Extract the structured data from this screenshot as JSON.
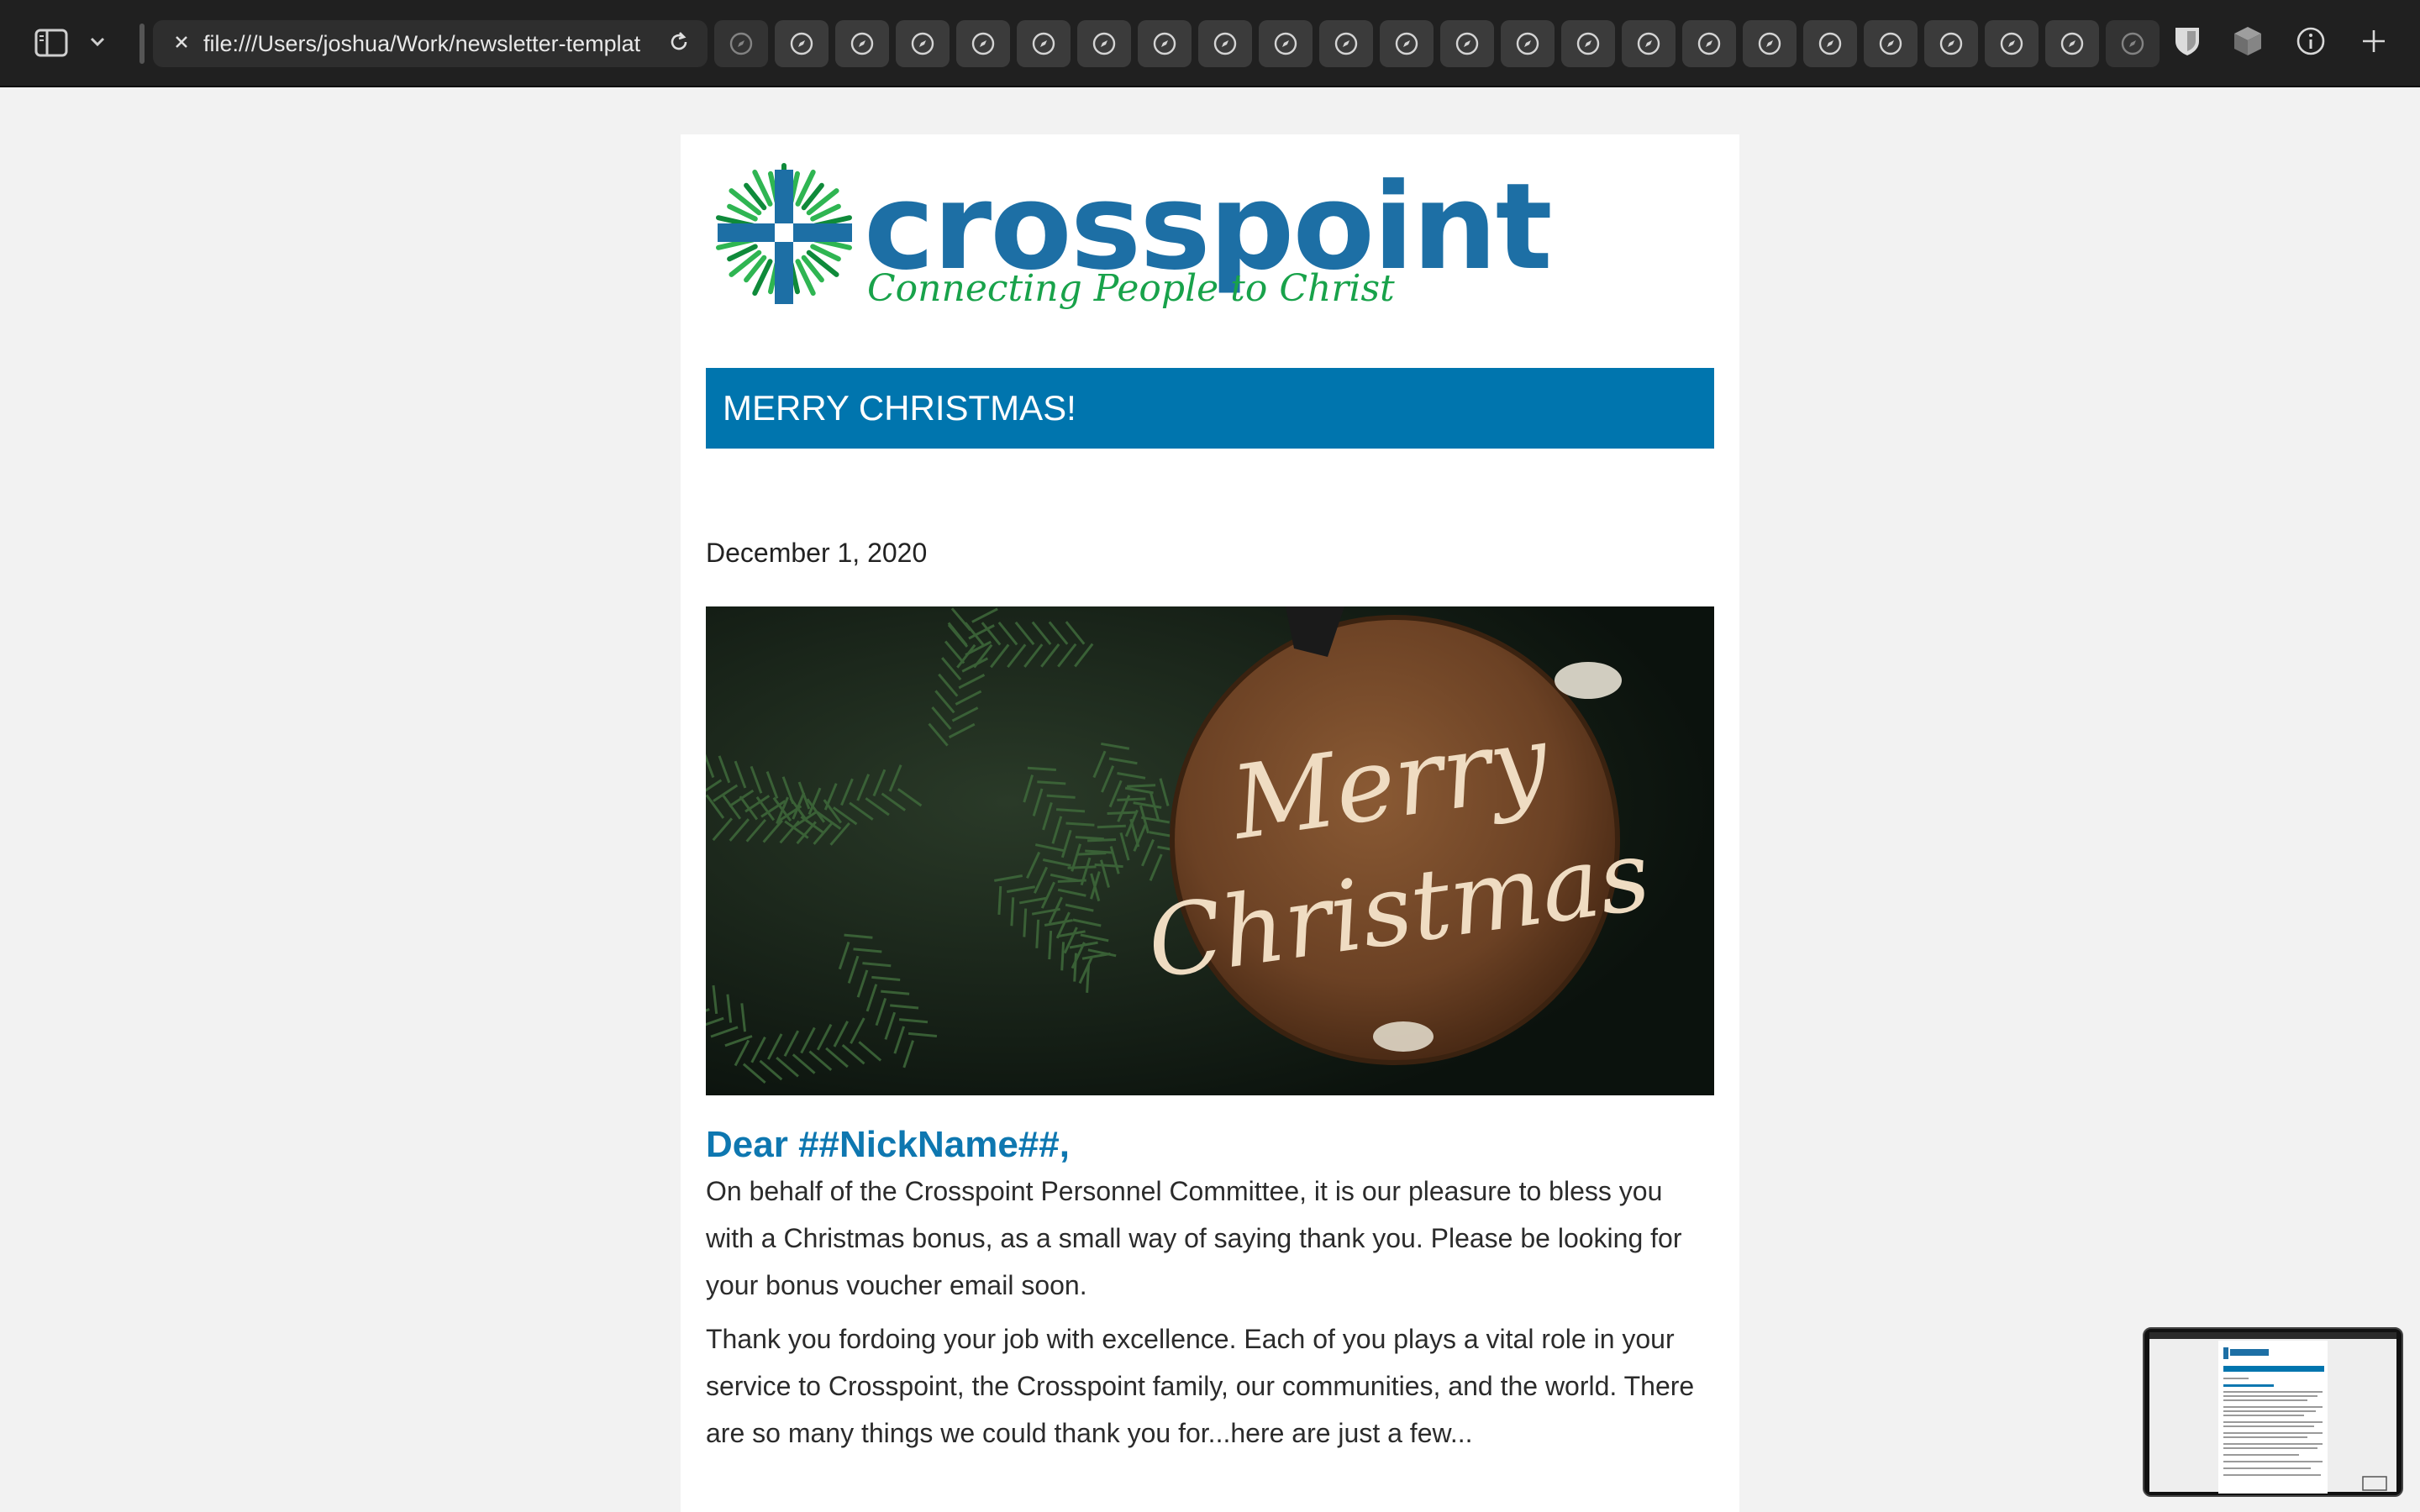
{
  "toolbar": {
    "url": "file:///Users/joshua/Work/newsletter-template.html",
    "icons": {
      "sidebar": "sidebar-icon",
      "chevron": "chevron-down-icon",
      "close": "close-icon",
      "reload": "reload-icon",
      "tab": "compass-icon",
      "shield": "shield-icon",
      "cube": "cube-icon",
      "info": "info-icon",
      "add": "plus-icon"
    }
  },
  "email": {
    "logo": {
      "wordmark": "crosspoint",
      "tagline": "Connecting People to Christ"
    },
    "banner": "MERRY CHRISTMAS!",
    "date": "December 1, 2020",
    "hero_image_text": "Merry Christmas",
    "greeting": "Dear ##NickName##,",
    "paragraphs": [
      "On behalf of the Crosspoint Personnel Committee, it is our pleasure to bless you with a Christmas bonus, as a small way of saying thank you. Please be looking for your bonus voucher email soon.",
      "Thank you fordoing your job with excellence. Each of you plays a vital role in your service to Crosspoint, the Crosspoint family, our communities, and the world. There are so many things we could thank you for...here are just a few..."
    ]
  },
  "colors": {
    "toolbar_bg": "#202020",
    "brand_blue": "#0075ae",
    "brand_green": "#18a24a",
    "greeting_blue": "#0e77b0"
  }
}
